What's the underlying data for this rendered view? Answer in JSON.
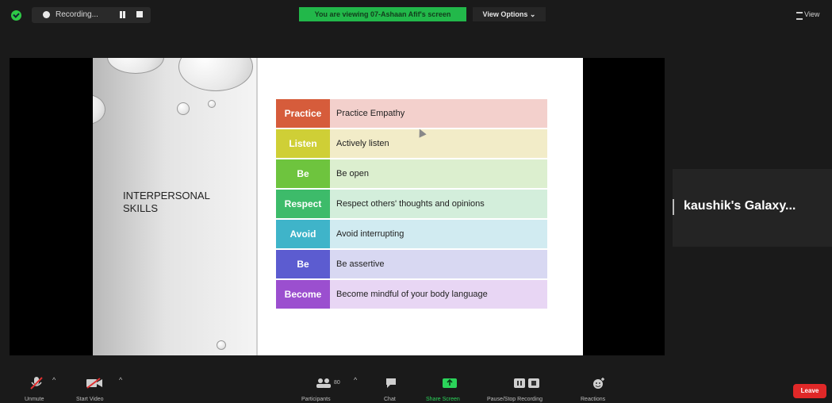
{
  "top_bar": {
    "recording_label": "Recording...",
    "viewing_banner": "You are viewing 07-Ashaan Afif's screen",
    "view_options": "View Options ⌄",
    "view_right": "View"
  },
  "slide": {
    "title": "INTERPERSONAL SKILLS",
    "rows": [
      {
        "key": "Practice",
        "value": "Practice Empathy",
        "key_color": "#d65c3b",
        "value_color": "#f3d0cc"
      },
      {
        "key": "Listen",
        "value": "Actively listen",
        "key_color": "#cfcf36",
        "value_color": "#f2ecc8"
      },
      {
        "key": "Be",
        "value": "Be open",
        "key_color": "#6ec43e",
        "value_color": "#dcefcf"
      },
      {
        "key": "Respect",
        "value": "Respect others' thoughts and opinions",
        "key_color": "#3dbb6a",
        "value_color": "#d3eedb"
      },
      {
        "key": "Avoid",
        "value": "Avoid interrupting",
        "key_color": "#3fb4c9",
        "value_color": "#d1ebf1"
      },
      {
        "key": "Be",
        "value": "Be assertive",
        "key_color": "#5c5cd0",
        "value_color": "#d8d8f2"
      },
      {
        "key": "Become",
        "value": "Become mindful of your body language",
        "key_color": "#9b4fcf",
        "value_color": "#e8d6f4"
      }
    ]
  },
  "side_tile": {
    "name": "kaushik's Galaxy..."
  },
  "toolbar": {
    "unmute": "Unmute",
    "start_video": "Start Video",
    "participants": "Participants",
    "participant_count": "80",
    "chat": "Chat",
    "share_screen": "Share Screen",
    "pause_stop_recording": "Pause/Stop Recording",
    "reactions": "Reactions",
    "leave": "Leave"
  },
  "colors": {
    "green": "#22b84a",
    "leave_red": "#e02828"
  }
}
